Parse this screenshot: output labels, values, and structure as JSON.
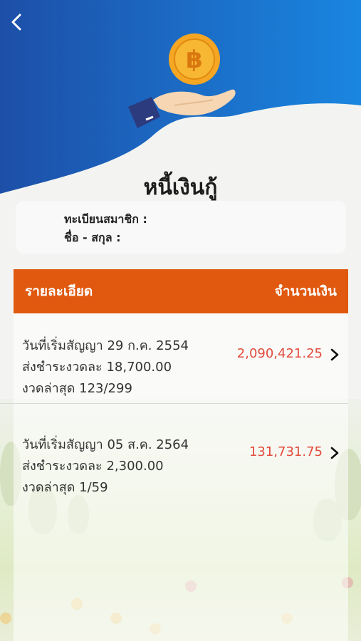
{
  "header": {
    "title": "หนี้เงินกู้",
    "back_icon": "chevron-left-icon",
    "illustration_icon": "hand-coin-baht-icon",
    "gradient_start": "#1d4fa8",
    "gradient_end": "#1a86e0"
  },
  "member": {
    "registration_label": "ทะเบียนสมาชิก :",
    "name_label": "ชื่อ - สกุล :"
  },
  "table": {
    "col_detail": "รายละเอียด",
    "col_amount": "จำนวนเงิน",
    "header_color": "#e0590f"
  },
  "loans": [
    {
      "start_date": "วันที่เริ่มสัญญา 29 ก.ค. 2554",
      "installment": "ส่งชำระงวดละ 18,700.00",
      "latest": "งวดล่าสุด 123/299",
      "amount": "2,090,421.25"
    },
    {
      "start_date": "วันที่เริ่มสัญญา 05 ส.ค. 2564",
      "installment": "ส่งชำระงวดละ 2,300.00",
      "latest": "งวดล่าสุด 1/59",
      "amount": "131,731.75"
    }
  ],
  "amount_color": "#e24a3b"
}
